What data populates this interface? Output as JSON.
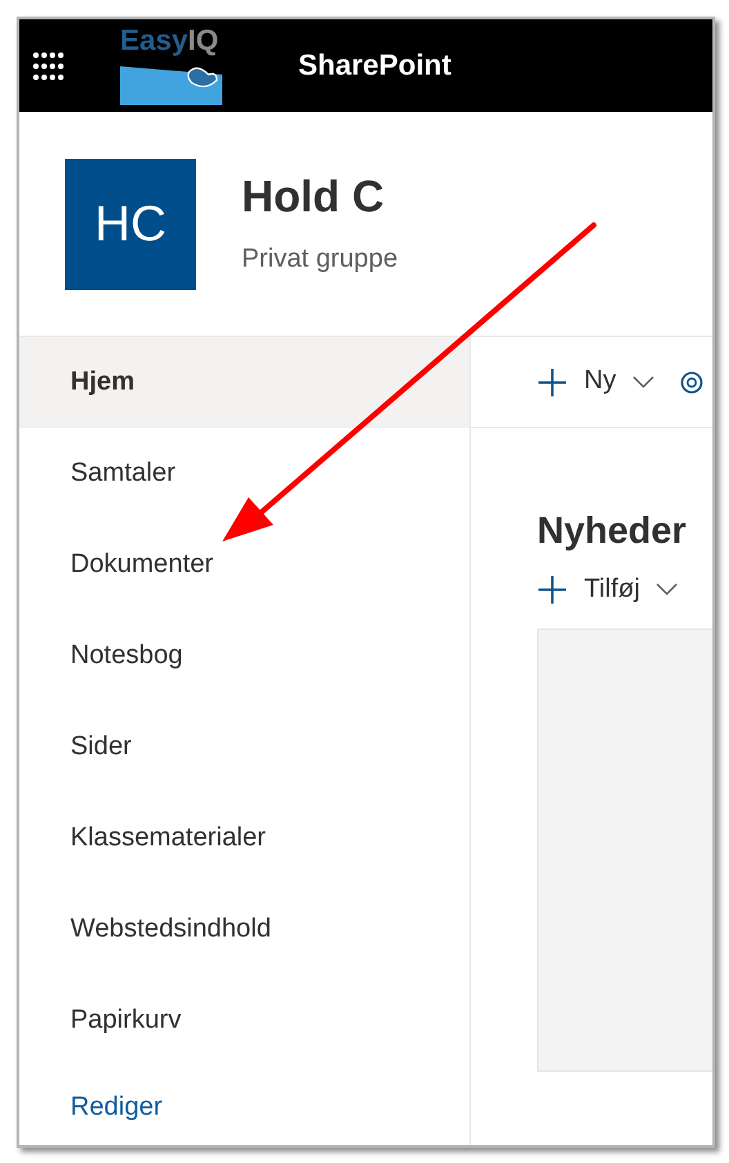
{
  "header": {
    "logo": {
      "first": "Easy",
      "second": "IQ"
    },
    "app_title": "SharePoint"
  },
  "site": {
    "initials": "HC",
    "title": "Hold C",
    "subtitle": "Privat gruppe"
  },
  "nav": {
    "items": [
      {
        "label": "Hjem",
        "selected": true
      },
      {
        "label": "Samtaler",
        "selected": false
      },
      {
        "label": "Dokumenter",
        "selected": false
      },
      {
        "label": "Notesbog",
        "selected": false
      },
      {
        "label": "Sider",
        "selected": false
      },
      {
        "label": "Klassematerialer",
        "selected": false
      },
      {
        "label": "Webstedsindhold",
        "selected": false
      },
      {
        "label": "Papirkurv",
        "selected": false
      }
    ],
    "edit_link": "Rediger"
  },
  "command_bar": {
    "new_label": "Ny"
  },
  "news": {
    "title": "Nyheder",
    "add_label": "Tilføj"
  }
}
